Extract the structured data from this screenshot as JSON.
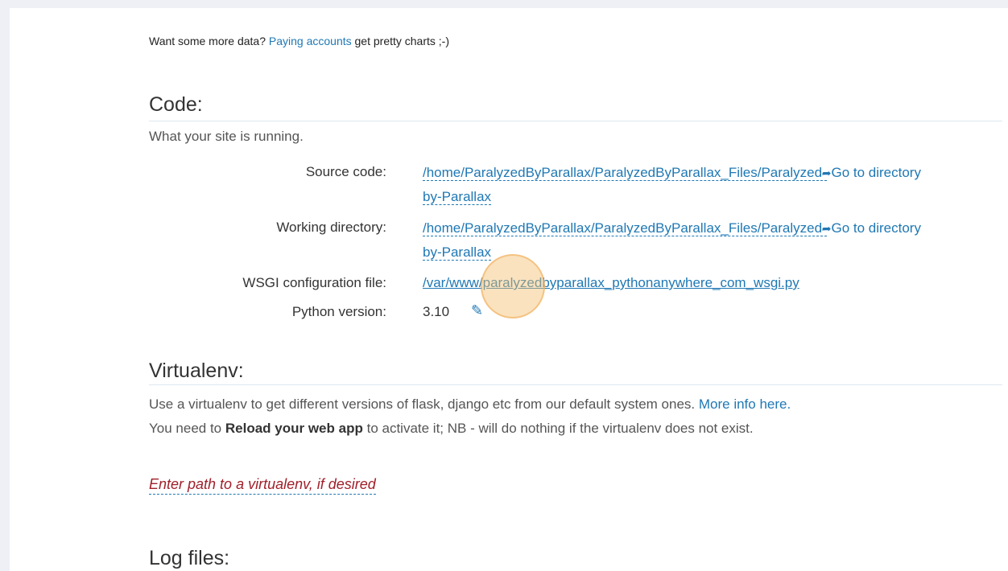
{
  "more_data": {
    "prefix": "Want some more data?",
    "link": "Paying accounts",
    "suffix": "get pretty charts ;-)"
  },
  "code": {
    "title": "Code:",
    "description": "What your site is running.",
    "source_code": {
      "label": "Source code:",
      "path_line1": "/home/ParalyzedByParallax/ParalyzedByParallax_Files/Paralyzed-",
      "path_line2": "by-Parallax",
      "goto": "Go to directory"
    },
    "working_directory": {
      "label": "Working directory:",
      "path_line1": "/home/ParalyzedByParallax/ParalyzedByParallax_Files/Paralyzed-",
      "path_line2": "by-Parallax",
      "goto": "Go to directory"
    },
    "wsgi": {
      "label": "WSGI configuration file:",
      "path": "/var/www/paralyzedbyparallax_pythonanywhere_com_wsgi.py"
    },
    "python": {
      "label": "Python version:",
      "value": "3.10"
    }
  },
  "virtualenv": {
    "title": "Virtualenv:",
    "text1": "Use a virtualenv to get different versions of flask, django etc from our default system ones.",
    "more_info": "More info here.",
    "text2": "You need to",
    "reload": "Reload your web app",
    "text3": "to activate it; NB - will do nothing if the virtualenv does not exist.",
    "input_placeholder": "Enter path to a virtualenv, if desired"
  },
  "log_files": {
    "title": "Log files:"
  }
}
